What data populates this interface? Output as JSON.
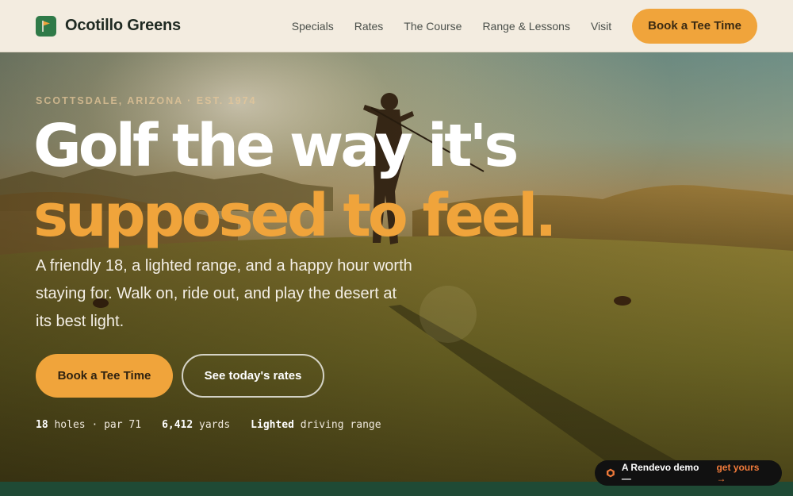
{
  "nav": {
    "brand": "Ocotillo Greens",
    "links": [
      "Specials",
      "Rates",
      "The Course",
      "Range & Lessons",
      "Visit"
    ],
    "cta": "Book a Tee Time"
  },
  "hero": {
    "eyebrow": "SCOTTSDALE, ARIZONA · EST. 1974",
    "headline_line1": "Golf the way it's",
    "headline_line2": "supposed to feel.",
    "subtext": "A friendly 18, a lighted range, and a happy hour worth staying for. Walk on, ride out, and play the desert at its best light.",
    "primary_button": "Book a Tee Time",
    "secondary_button": "See today's rates",
    "facts": [
      {
        "strong": "18",
        "rest": "holes · par 71"
      },
      {
        "strong": "6,412",
        "rest": "yards"
      },
      {
        "strong": "Lighted",
        "rest": "driving range"
      }
    ]
  },
  "badge": {
    "text": "A Rendevo demo —",
    "link": "get yours →"
  },
  "colors": {
    "accent": "#f0a43b",
    "brand_green": "#2f7a48",
    "nav_bg": "#f3ece0",
    "footer_green": "#1f4a35"
  },
  "icons": {
    "logo": "golf-flag-icon",
    "badge": "rendevo-hex-icon"
  }
}
